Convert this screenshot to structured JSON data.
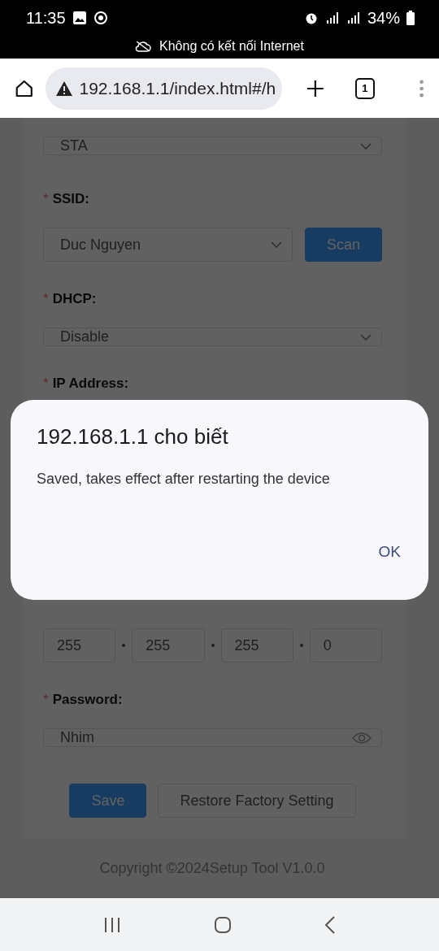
{
  "status_bar": {
    "time": "11:35",
    "battery": "34%",
    "notice": "Không có kết nối Internet"
  },
  "browser": {
    "url": "192.168.1.1/index.html#/h",
    "tab_count": "1"
  },
  "form": {
    "fields": [
      {
        "kind": "select",
        "value": "STA"
      },
      {
        "mark": "*",
        "label": "SSID:",
        "kind": "select_button",
        "value": "Duc Nguyen",
        "button": "Scan"
      },
      {
        "mark": "*",
        "label": "DHCP:",
        "kind": "select",
        "value": "Disable"
      },
      {
        "mark": "*",
        "label": "IP Address:",
        "kind": "covered"
      },
      {
        "kind": "ip",
        "octets": [
          "255",
          "255",
          "255",
          "0"
        ]
      },
      {
        "mark": "*",
        "label": "Password:",
        "kind": "password",
        "value": "Nhim"
      }
    ],
    "buttons": [
      {
        "label": "Save",
        "kind": "primary"
      },
      {
        "label": "Restore Factory Setting",
        "kind": "plain"
      }
    ]
  },
  "footer": "Copyright ©2024Setup Tool V1.0.0",
  "dialog": {
    "title": "192.168.1.1 cho biết",
    "message": "Saved, takes effect after restarting the device",
    "button": "OK"
  }
}
